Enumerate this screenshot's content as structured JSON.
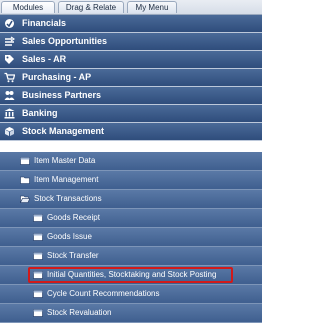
{
  "tabs": [
    {
      "label": "Modules"
    },
    {
      "label": "Drag & Relate"
    },
    {
      "label": "My Menu"
    }
  ],
  "modules": [
    {
      "label": "Financials",
      "icon": "financials-icon"
    },
    {
      "label": "Sales Opportunities",
      "icon": "opportunities-icon"
    },
    {
      "label": "Sales - AR",
      "icon": "sales-tag-icon"
    },
    {
      "label": "Purchasing - AP",
      "icon": "shopping-cart-icon"
    },
    {
      "label": "Business Partners",
      "icon": "partners-icon"
    },
    {
      "label": "Banking",
      "icon": "bank-icon"
    },
    {
      "label": "Stock Management",
      "icon": "stock-icon"
    }
  ],
  "tree": [
    {
      "label": "Item Master Data",
      "icon": "document-icon"
    },
    {
      "label": "Item Management",
      "icon": "folder-icon"
    },
    {
      "label": "Stock Transactions",
      "icon": "open-folder-icon"
    },
    {
      "label": "Goods Receipt",
      "icon": "document-icon"
    },
    {
      "label": "Goods Issue",
      "icon": "document-icon"
    },
    {
      "label": "Stock Transfer",
      "icon": "document-icon"
    },
    {
      "label": "Initial Quantities, Stocktaking and Stock Posting",
      "icon": "document-icon"
    },
    {
      "label": "Cycle Count Recommendations",
      "icon": "document-icon"
    },
    {
      "label": "Stock Revaluation",
      "icon": "document-icon"
    }
  ],
  "colors": {
    "module_bg": "#2f4d7c",
    "tree_bg": "#3f5f8f",
    "highlight": "#d11a1a"
  }
}
